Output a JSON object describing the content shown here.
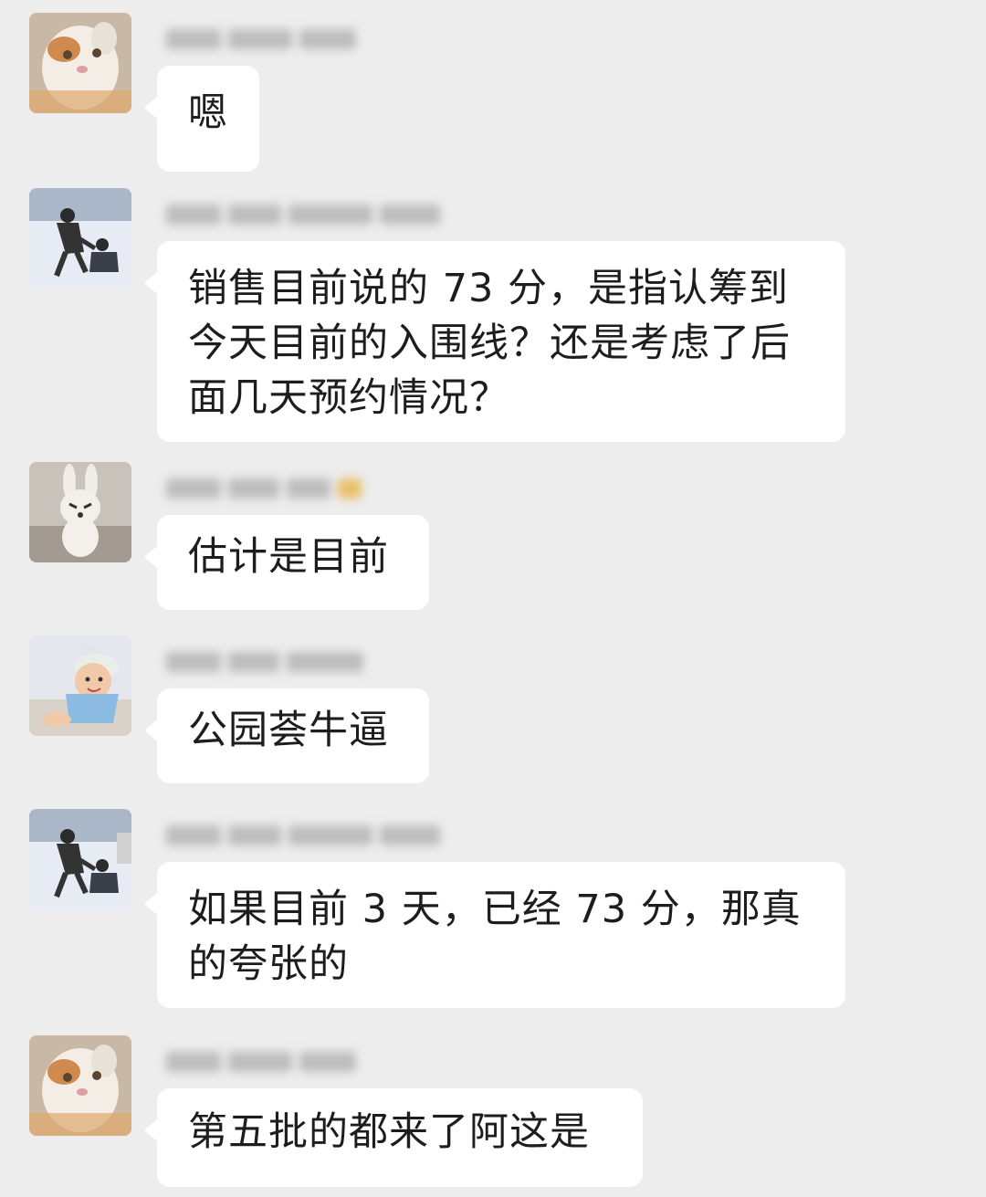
{
  "messages": [
    {
      "text": "嗯"
    },
    {
      "text": "销售目前说的 73 分，是指认筹到今天目前的入围线？还是考虑了后面几天预约情况？"
    },
    {
      "text": "估计是目前"
    },
    {
      "text": "公园荟牛逼"
    },
    {
      "text": "如果目前 3 天，已经 73 分，那真的夸张的"
    },
    {
      "text": "第五批的都来了阿这是"
    }
  ],
  "avatars": [
    "cat-avatar",
    "people-snow-avatar",
    "rabbit-avatar",
    "baby-avatar",
    "people-snow-avatar",
    "cat-avatar"
  ],
  "colors": {
    "background": "#ededed",
    "bubble": "#ffffff",
    "text": "#1d1d1d"
  }
}
